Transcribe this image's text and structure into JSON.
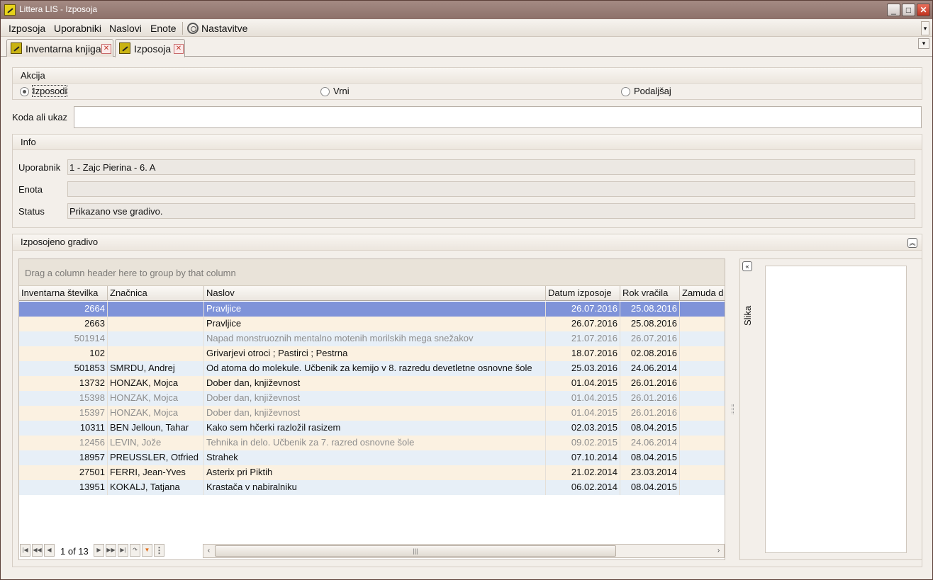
{
  "window": {
    "title": "Littera LIS - Izposoja"
  },
  "menu": {
    "items": [
      "Izposoja",
      "Uporabniki",
      "Naslovi",
      "Enote"
    ],
    "settings_label": "Nastavitve"
  },
  "tabs": [
    {
      "label": "Inventarna knjiga",
      "active": false
    },
    {
      "label": "Izposoja",
      "active": true
    }
  ],
  "akcija": {
    "title": "Akcija",
    "options": [
      "Izposodi",
      "Vrni",
      "Podaljšaj"
    ],
    "selected": "Izposodi"
  },
  "code_field": {
    "label": "Koda ali ukaz",
    "value": ""
  },
  "info": {
    "title": "Info",
    "uporabnik_label": "Uporabnik",
    "uporabnik_value": "1 - Zajc Pierina - 6. A",
    "enota_label": "Enota",
    "enota_value": "",
    "status_label": "Status",
    "status_value": "Prikazano vse gradivo."
  },
  "grid": {
    "section_title": "Izposojeno gradivo",
    "group_hint": "Drag a column header here to group by that column",
    "columns": [
      "Inventarna številka",
      "Značnica",
      "Naslov",
      "Datum izposoje",
      "Rok vračila",
      "Zamuda d"
    ],
    "rows": [
      {
        "inv": "2664",
        "znacnica": "",
        "naslov": "Pravljice",
        "datum": "26.07.2016",
        "rok": "25.08.2016",
        "selected": true,
        "dim": false
      },
      {
        "inv": "2663",
        "znacnica": "",
        "naslov": "Pravljice",
        "datum": "26.07.2016",
        "rok": "25.08.2016",
        "selected": false,
        "dim": false
      },
      {
        "inv": "501914",
        "znacnica": "",
        "naslov": "Napad monstruoznih mentalno motenih morilskih mega snežakov",
        "datum": "21.07.2016",
        "rok": "26.07.2016",
        "selected": false,
        "dim": true
      },
      {
        "inv": "102",
        "znacnica": "",
        "naslov": "Grivarjevi otroci ; Pastirci ; Pestrna",
        "datum": "18.07.2016",
        "rok": "02.08.2016",
        "selected": false,
        "dim": false
      },
      {
        "inv": "501853",
        "znacnica": "SMRDU, Andrej",
        "naslov": "Od atoma do molekule. Učbenik za kemijo v 8. razredu devetletne osnovne šole",
        "datum": "25.03.2016",
        "rok": "24.06.2014",
        "selected": false,
        "dim": false
      },
      {
        "inv": "13732",
        "znacnica": "HONZAK, Mojca",
        "naslov": "Dober dan, književnost",
        "datum": "01.04.2015",
        "rok": "26.01.2016",
        "selected": false,
        "dim": false
      },
      {
        "inv": "15398",
        "znacnica": "HONZAK, Mojca",
        "naslov": "Dober dan, književnost",
        "datum": "01.04.2015",
        "rok": "26.01.2016",
        "selected": false,
        "dim": true
      },
      {
        "inv": "15397",
        "znacnica": "HONZAK, Mojca",
        "naslov": "Dober dan, književnost",
        "datum": "01.04.2015",
        "rok": "26.01.2016",
        "selected": false,
        "dim": true
      },
      {
        "inv": "10311",
        "znacnica": "BEN Jelloun, Tahar",
        "naslov": "Kako sem hčerki razložil rasizem",
        "datum": "02.03.2015",
        "rok": "08.04.2015",
        "selected": false,
        "dim": false
      },
      {
        "inv": "12456",
        "znacnica": "LEVIN, Jože",
        "naslov": "Tehnika in delo. Učbenik za 7. razred osnovne šole",
        "datum": "09.02.2015",
        "rok": "24.06.2014",
        "selected": false,
        "dim": true
      },
      {
        "inv": "18957",
        "znacnica": "PREUSSLER, Otfried",
        "naslov": "Strahek",
        "datum": "07.10.2014",
        "rok": "08.04.2015",
        "selected": false,
        "dim": false
      },
      {
        "inv": "27501",
        "znacnica": "FERRI, Jean-Yves",
        "naslov": "Asterix pri Piktih",
        "datum": "21.02.2014",
        "rok": "23.03.2014",
        "selected": false,
        "dim": false
      },
      {
        "inv": "13951",
        "znacnica": "KOKALJ, Tatjana",
        "naslov": "Krastača v nabiralniku",
        "datum": "06.02.2014",
        "rok": "08.04.2015",
        "selected": false,
        "dim": false
      }
    ],
    "pager_text": "1 of 13"
  },
  "side_panel": {
    "label": "Slika"
  }
}
